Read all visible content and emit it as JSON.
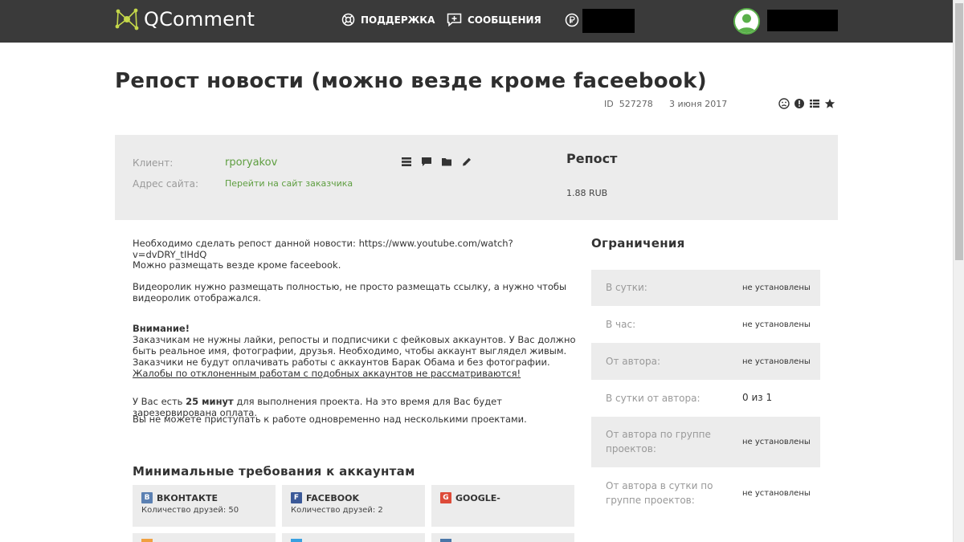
{
  "header": {
    "brand": "QComment",
    "nav_support": "Поддержка",
    "nav_messages": "Сообщения"
  },
  "task": {
    "title": "Репост новости (можно везде кроме faceebook)",
    "id_label": "ID",
    "id_value": "527278",
    "date": "3 июня 2017"
  },
  "info": {
    "client_label": "Клиент:",
    "client_value": "rporyakov",
    "site_label": "Адрес сайта:",
    "site_value": "Перейти на сайт заказчика",
    "type_title": "Репост",
    "price": "1.88 RUB"
  },
  "description": {
    "line1": "Необходимо сделать репост данной новости: https://www.youtube.com/watch?v=dvDRY_tIHdQ",
    "line2": "Можно размещать везде кроме faceebook.",
    "line3": "Видеоролик нужно размещать полностью, не просто размещать ссылку, а нужно чтобы видеоролик отображался.",
    "warning_title": "Внимание!",
    "warning_text": "Заказчикам не нужны лайки, репосты и подписчики с фейковых аккаунтов. У Вас должно быть реальное имя, фотографии, друзья. Необходимо, чтобы аккаунт выглядел живым.",
    "warning_text2": "Заказчики не будут оплачивать работы с аккаунтов Барак Обама и без фотографии.",
    "warning_link": "Жалобы по отклоненным работам с подобных аккаунтов не рассматриваются!",
    "time_prefix": "У Вас есть ",
    "time_value": "25 минут",
    "time_suffix": " для выполнения проекта. На это время для Вас будет зарезервирована оплата.",
    "parallel_note": "Вы не можете приступать к работе одновременно над несколькими проектами."
  },
  "restrictions": {
    "title": "Ограничения",
    "rows": [
      {
        "label": "В сутки:",
        "value": "не установлены"
      },
      {
        "label": "В час:",
        "value": "не установлены"
      },
      {
        "label": "От автора:",
        "value": "не установлены"
      },
      {
        "label": "В сутки от автора:",
        "value": "0 из 1"
      },
      {
        "label": "От автора по группе проектов:",
        "value": "не установлены"
      },
      {
        "label": "От автора в сутки по группе проектов:",
        "value": "не установлены"
      }
    ]
  },
  "requirements": {
    "title": "Минимальные требования к аккаунтам",
    "cards": [
      {
        "name": "ВКонтакте",
        "sub": "Количество друзей: 50",
        "icon_letter": "В",
        "color": "#5b80b2"
      },
      {
        "name": "Facebook",
        "sub": "Количество друзей: 2",
        "icon_letter": "f",
        "color": "#3b5998"
      },
      {
        "name": "Google-",
        "sub": "",
        "icon_letter": "g",
        "color": "#dd4b39"
      }
    ]
  },
  "colors": {
    "header_bg": "#3a3a3a",
    "accent_green": "#5e9e40",
    "panel_gray": "#ececec"
  }
}
